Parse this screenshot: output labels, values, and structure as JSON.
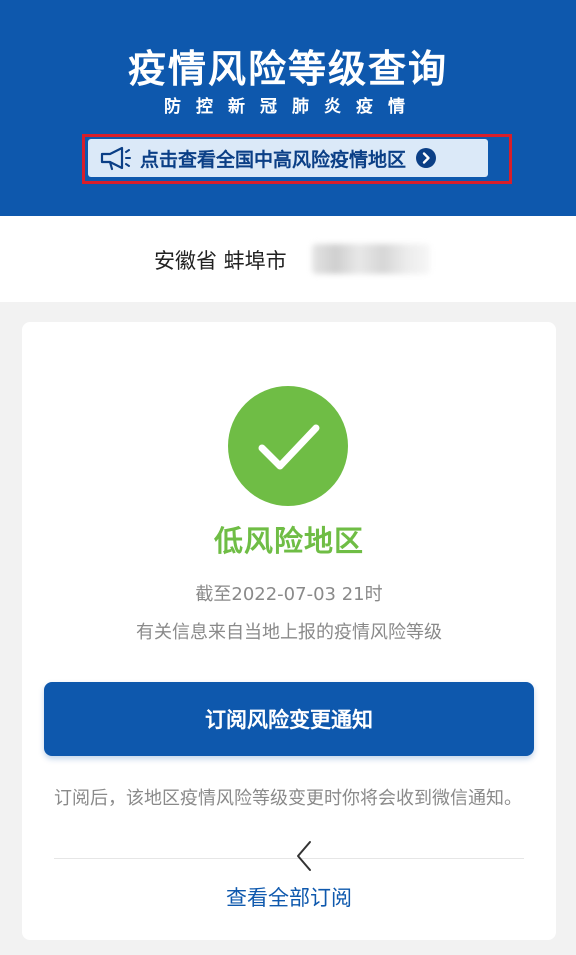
{
  "header": {
    "title": "疫情风险等级查询",
    "subtitle": "防控新冠肺炎疫情",
    "notice_text": "点击查看全国中高风险疫情地区",
    "icons": {
      "notice": "megaphone-icon",
      "arrow": "chevron-right-circle-icon"
    }
  },
  "location": {
    "text": "安徽省 蚌埠市"
  },
  "status": {
    "level": "低风险地区",
    "as_of": "截至2022-07-03 21时",
    "source": "有关信息来自当地上报的疫情风险等级",
    "icon": "check-circle-icon"
  },
  "subscribe": {
    "button_label": "订阅风险变更通知",
    "note": "订阅后，该地区疫情风险等级变更时你将会收到微信通知。"
  },
  "view_all_label": "查看全部订阅",
  "colors": {
    "primary": "#0e58ad",
    "success": "#6fbd45",
    "highlight_outline": "#d81e2a",
    "notice_bg": "#dbe9f8"
  }
}
